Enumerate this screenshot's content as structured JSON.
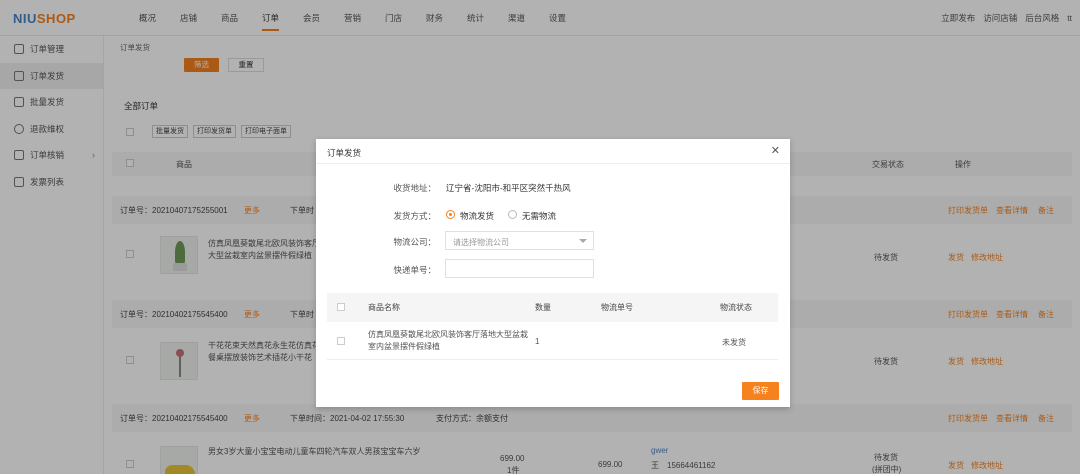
{
  "logo": {
    "prefix": "NIU",
    "suffix": "SHOP"
  },
  "nav": [
    "概况",
    "店铺",
    "商品",
    "订单",
    "会员",
    "营销",
    "门店",
    "财务",
    "统计",
    "渠道",
    "设置"
  ],
  "nav_active": 3,
  "top_right": [
    "立即发布",
    "访问店铺",
    "后台风格",
    "tt"
  ],
  "sidebar": [
    {
      "label": "订单管理",
      "icon": "document-icon"
    },
    {
      "label": "订单发货",
      "icon": "shipping-icon"
    },
    {
      "label": "批量发货",
      "icon": "truck-icon"
    },
    {
      "label": "退款维权",
      "icon": "refund-icon"
    },
    {
      "label": "订单核销",
      "icon": "verify-icon"
    },
    {
      "label": "发票列表",
      "icon": "invoice-icon"
    }
  ],
  "main": {
    "breadcrumb": "订单发货",
    "search_label": "筛选",
    "reset_label": "重置",
    "section_title": "全部订单",
    "tools": [
      "批量发货",
      "打印发货单",
      "打印电子面单"
    ],
    "table_headers": {
      "goods": "商品",
      "status": "交易状态",
      "ops": "操作"
    },
    "orders": [
      {
        "order_no": "订单号：20210407175255001",
        "more": "更多",
        "time": "下单时",
        "payment": "",
        "actions": [
          "打印发货单",
          "查看详情",
          "备注"
        ],
        "goods_name": "仿真凤凰葵散尾北欧风装饰客厅落地大型盆栽室内盆景摆件假绿植",
        "status": "待发货",
        "ops": [
          "发货",
          "修改地址"
        ]
      },
      {
        "order_no": "订单号：20210402175545400",
        "more": "更多",
        "time": "下单时",
        "payment": "",
        "actions": [
          "打印发货单",
          "查看详情",
          "备注"
        ],
        "goods_name": "干花花束天然真花永生花仿真花茶几餐桌摆放装饰艺术插花小干花",
        "status": "待发货",
        "ops": [
          "发货",
          "修改地址"
        ]
      },
      {
        "order_no": "订单号：20210402175545400",
        "more": "更多",
        "time": "下单时间：2021-04-02 17:55:30",
        "payment": "支付方式：余额支付",
        "actions": [
          "打印发货单",
          "查看详情",
          "备注"
        ],
        "goods_name": "男女3岁大童小宝宝电动儿童车四轮汽车双人男孩宝宝车六岁",
        "price": "699.00",
        "qty": "1件",
        "total": "699.00",
        "buyer": "gwer",
        "buyer_line": "王　15664461162",
        "status": "待发货",
        "status_sub": "(拼团中)",
        "ops": [
          "发货",
          "修改地址"
        ]
      }
    ]
  },
  "dialog": {
    "title": "订单发货",
    "address_label": "收货地址：",
    "address": "辽宁省-沈阳市-和平区突然千热风",
    "method_label": "发货方式：",
    "method_options": [
      "物流发货",
      "无需物流"
    ],
    "company_label": "物流公司：",
    "company_placeholder": "请选择物流公司",
    "tracking_label": "快递单号：",
    "tracking_value": "",
    "table_headers": [
      "商品名称",
      "数量",
      "物流单号",
      "物流状态"
    ],
    "rows": [
      {
        "name": "仿真凤凰葵散尾北欧风装饰客厅落地大型盆栽室内盆景摆件假绿植",
        "qty": "1",
        "tracking": "",
        "status": "未发货"
      }
    ],
    "save_label": "保存"
  }
}
